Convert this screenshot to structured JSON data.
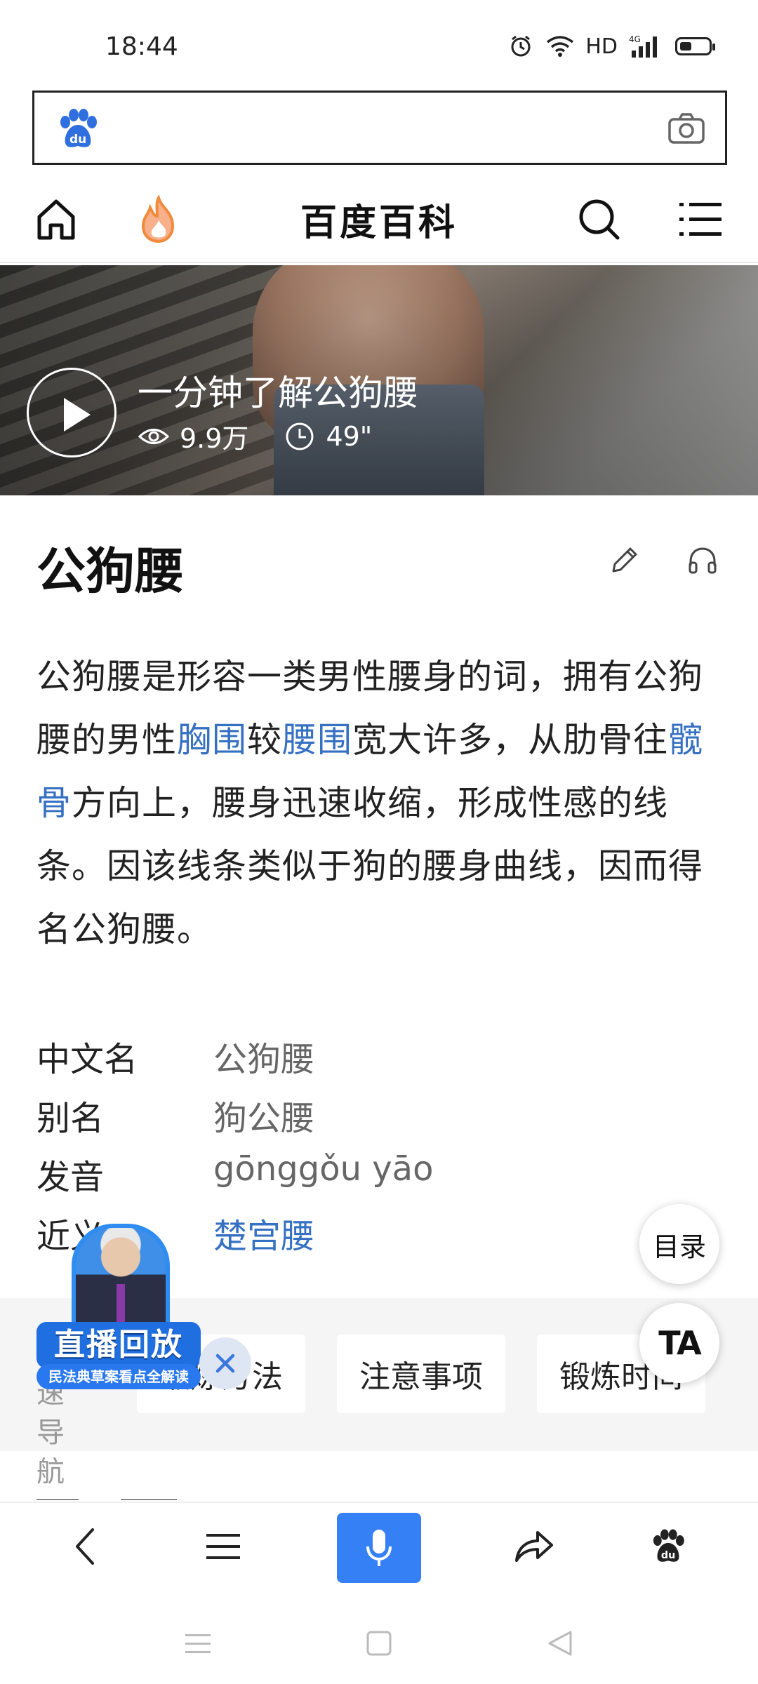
{
  "status_bar": {
    "time": "18:44",
    "hd": "HD",
    "network": "4G"
  },
  "search": {
    "logo": "baidu-paw-icon",
    "camera": "camera-icon"
  },
  "header": {
    "title": "百度百科",
    "home_icon": "home-icon",
    "hot_icon": "flame-icon",
    "search_icon": "search-icon",
    "menu_icon": "list-icon"
  },
  "video": {
    "title": "一分钟了解公狗腰",
    "views": "9.9万",
    "duration": "49\""
  },
  "article": {
    "title": "公狗腰",
    "summary": {
      "part1": "公狗腰是形容一类男性腰身的词，拥有公狗腰的男性",
      "link1": "胸围",
      "part2": "较",
      "link2": "腰围",
      "part3": "宽大许多，从肋骨往",
      "link3": "髋骨",
      "part4": "方向上，腰身迅速收缩，形成性感的线条。因该线条类似于狗的腰身曲线，因而得名公狗腰。"
    },
    "info": [
      {
        "label": "中文名",
        "value": "公狗腰"
      },
      {
        "label": "别名",
        "value": "狗公腰"
      },
      {
        "label": "发音",
        "value": "gōnggǒu yāo"
      },
      {
        "label": "近义",
        "value": "楚宫腰"
      }
    ]
  },
  "float_buttons": {
    "toc": "目录",
    "ta": "TA"
  },
  "section_nav": {
    "label": "快速导航",
    "chips": [
      "锻炼方法",
      "注意事项",
      "锻炼时间"
    ]
  },
  "promo": {
    "badge": "直播回放",
    "sub": "民法典草案看点全解读"
  },
  "colors": {
    "link": "#3570c2",
    "accent": "#3580f5",
    "flame": "#f08a3c"
  }
}
